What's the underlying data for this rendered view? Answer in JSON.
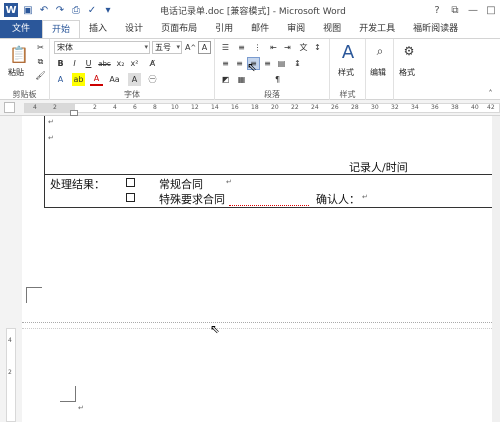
{
  "window": {
    "title": "电话记录单.doc [兼容模式] - Microsoft Word",
    "controls": [
      "?",
      "⧉",
      "—",
      "□"
    ]
  },
  "tabs": [
    "文件",
    "开始",
    "插入",
    "设计",
    "页面布局",
    "引用",
    "邮件",
    "审阅",
    "视图",
    "开发工具",
    "福昕阅读器"
  ],
  "ribbon": {
    "clipboard": {
      "paste": "粘贴",
      "group": "剪贴板"
    },
    "font": {
      "font_name": "宋体",
      "font_size": "五号",
      "group": "字体"
    },
    "paragraph": {
      "group": "段落"
    },
    "styles": {
      "label": "样式",
      "group": "样式"
    },
    "editing": {
      "label": "编辑"
    },
    "format": {
      "label": "格式"
    }
  },
  "ruler": {
    "ticks": [
      "4",
      "2",
      "",
      "2",
      "4",
      "6",
      "8",
      "10",
      "12",
      "14",
      "16",
      "18",
      "20",
      "22",
      "24",
      "26",
      "28",
      "30",
      "32",
      "34",
      "36",
      "38",
      "40",
      "42",
      "44"
    ],
    "vticks": [
      "4",
      "2"
    ]
  },
  "document": {
    "recorder": "记录人/时间",
    "result_label": "处理结果：",
    "option1": "常规合同",
    "option2": "特殊要求合同",
    "confirm": "确认人："
  }
}
